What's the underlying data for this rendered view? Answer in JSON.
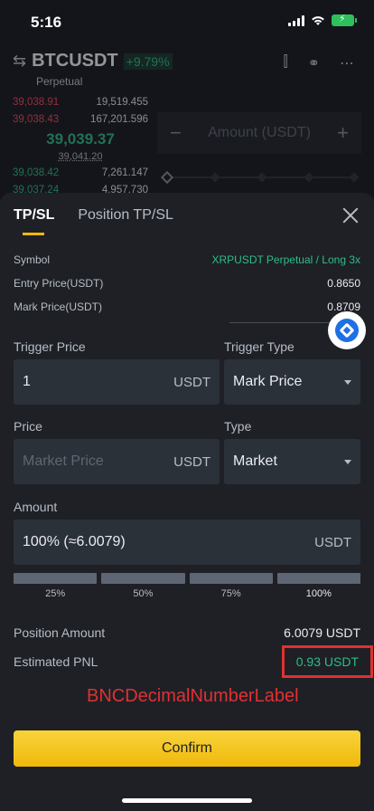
{
  "status_bar": {
    "time": "5:16"
  },
  "background": {
    "pair": "BTCUSDT",
    "change": "+9.79%",
    "contract_type": "Perpetual",
    "asks": [
      {
        "price": "39,038.91",
        "qty": "19,519.455"
      },
      {
        "price": "39,038.43",
        "qty": "167,201.596"
      }
    ],
    "last_price": "39,039.37",
    "index_price": "39,041.20",
    "bids": [
      {
        "price": "39,038.42",
        "qty": "7,261.147"
      },
      {
        "price": "39,037.24",
        "qty": "4,957.730"
      }
    ],
    "amount_placeholder": "Amount (USDT)",
    "minus": "−",
    "plus": "+"
  },
  "sheet": {
    "tabs": [
      {
        "label": "TP/SL",
        "active": true
      },
      {
        "label": "Position TP/SL",
        "active": false
      }
    ],
    "info": [
      {
        "label": "Symbol",
        "value": "XRPUSDT Perpetual / Long 3x"
      },
      {
        "label": "Entry Price(USDT)",
        "value": "0.8650"
      },
      {
        "label": "Mark Price(USDT)",
        "value": "0.8709"
      }
    ],
    "trigger_price": {
      "label": "Trigger Price",
      "value": "1",
      "unit": "USDT"
    },
    "trigger_type": {
      "label": "Trigger Type",
      "value": "Mark Price"
    },
    "price": {
      "label": "Price",
      "placeholder": "Market Price",
      "unit": "USDT"
    },
    "type": {
      "label": "Type",
      "value": "Market"
    },
    "amount": {
      "label": "Amount",
      "value": "100% (≈6.0079)",
      "unit": "USDT"
    },
    "percent_options": [
      "25%",
      "50%",
      "75%",
      "100%"
    ],
    "selected_percent": 1.0,
    "position_amount": {
      "label": "Position Amount",
      "value": "6.0079 USDT"
    },
    "estimated_pnl": {
      "label": "Estimated PNL",
      "value": "0.93 USDT"
    },
    "annotation": "BNCDecimalNumberLabel",
    "confirm_label": "Confirm"
  },
  "colors": {
    "accent": "#f0b90b",
    "positive": "#2ebd85",
    "negative": "#f6465d",
    "annotation": "#e03131"
  }
}
